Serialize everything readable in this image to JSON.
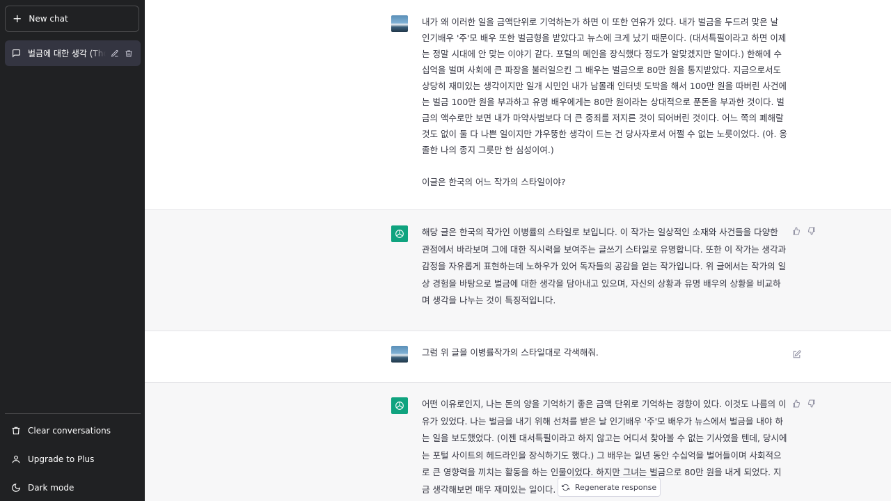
{
  "sidebar": {
    "new_chat_label": "New chat",
    "chat_title": "벌금에 대한 생각 (Thoughts on Fines)",
    "bottom": {
      "clear": "Clear conversations",
      "upgrade": "Upgrade to Plus",
      "dark": "Dark mode"
    }
  },
  "messages": {
    "user1": "내가 왜 이러한 일을 금액단위로 기억하는가 하면 이 또한 연유가 있다. 내가 벌금을 두드려 맞은 날 인기배우 '주'모 배우 또한 벌금형을 받았다고 뉴스에 크게 났기 때문이다. (대서특필이라고 하면 이제는 정말 시대에 안 맞는 이야기 같다. 포털의 메인을 장식했다 정도가 알맞겠지만 말이다.) 한해에 수십억을 벌며 사회에 큰 파장을 불러일으킨 그 배우는 벌금으로 80만 원을 통지받았다. 지금으로서도 상당히 재미있는 생각이지만 일개 시민인 내가 남몰래 인터넷 도박을 해서 100만 원을 따버린 사건에는 벌금 100만 원을 부과하고 유명 배우에게는 80만 원이라는 상대적으로 푼돈을 부과한 것이다. 벌금의 액수로만 보면 내가 마약사범보다 더 큰 중죄를 저지른 것이 되어버린 것이다. 어느 쪽의 폐해랄 것도 없이 둘 다 나쁜 일이지만 갸우뚱한 생각이 드는 건 당사자로서 어쩔 수 없는 노릇이었다. (아. 옹졸한 나의 종지 그릇만 한 심성이여.)\n\n이글은 한국의 어느 작가의 스타일이야?",
    "assistant1": "해당 글은 한국의 작가인 이병률의 스타일로 보입니다. 이 작가는 일상적인 소재와 사건들을 다양한 관점에서 바라보며 그에 대한 직시력을 보여주는 글쓰기 스타일로 유명합니다. 또한 이 작가는 생각과 감정을 자유롭게 표현하는데 노하우가 있어 독자들의 공감을 얻는 작가입니다. 위 글에서는 작가의 일상 경험을 바탕으로 벌금에 대한 생각을 담아내고 있으며, 자신의 상황과 유명 배우의 상황을 비교하며 생각을 나누는 것이 특징적입니다.",
    "user2": "그럼 위 글을 이병률작가의 스타일대로 각색해줘.",
    "assistant2": "어떤 이유로인지, 나는 돈의 양을 기억하기 좋은 금액 단위로 기억하는 경향이 있다. 이것도 나름의 이유가 있었다. 나는 벌금을 내기 위해 선처를 받은 날 인기배우 '주'모 배우가 뉴스에서 벌금을 내야 하는 일을 보도했었다. (이젠 대서특필이라고 하지 않고는 어디서 찾아볼 수 없는 기사였을 텐데, 당시에는 포털 사이트의 헤드라인을 장식하기도 했다.) 그 배우는 일년 동안 수십억을 벌어들이며 사회적으로 큰 영향력을 끼치는 활동을 하는 인물이었다. 하지만 그녀는 벌금으로 80만 원을 내게 되었다. 지금 생각해보면 매우 재미있는 일이다. 하"
  },
  "regenerate_label": "Regenerate response"
}
